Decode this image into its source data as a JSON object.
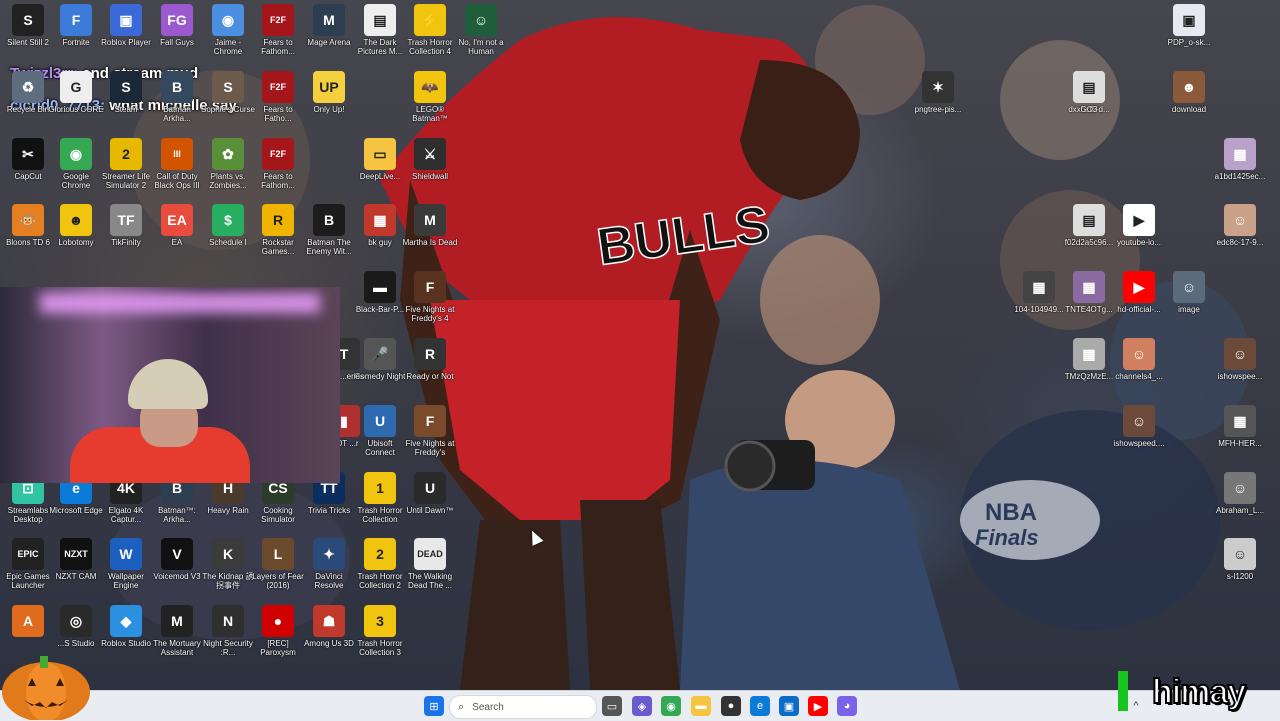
{
  "overlay_chat": [
    {
      "user": "Twizzl3rr:",
      "message": "end stream mud"
    },
    {
      "user": "cicrld0_7713:",
      "message": "what michelle say"
    }
  ],
  "desktop_icons": [
    {
      "label": "Silent Still 2",
      "glyph": "S",
      "color": "#222222"
    },
    {
      "label": "Fortnite",
      "glyph": "F",
      "color": "#3d7bd9"
    },
    {
      "label": "Roblox Player",
      "glyph": "▣",
      "color": "#3b6ad8"
    },
    {
      "label": "Fall Guys",
      "glyph": "FG",
      "color": "#9b59d0"
    },
    {
      "label": "Jaime - Chrome",
      "glyph": "◉",
      "color": "#4a8fe0"
    },
    {
      "label": "Fears to Fathom...",
      "glyph": "F2F",
      "color": "#a4161a"
    },
    {
      "label": "Mage Arena",
      "glyph": "M",
      "color": "#2c3e50"
    },
    {
      "label": "The Dark Pictures M...",
      "glyph": "▤",
      "color": "#eeeeee"
    },
    {
      "label": "Trash Horror Collection 4",
      "glyph": "⚡",
      "color": "#f1c40f"
    },
    {
      "label": "No, I'm not a Human",
      "glyph": "☺",
      "color": "#1e5e3a"
    },
    {
      "label": "Recycle Bin",
      "glyph": "♻",
      "color": "#5d6d7e"
    },
    {
      "label": "Glorious CORE",
      "glyph": "G",
      "color": "#eeeeee"
    },
    {
      "label": "Steam",
      "glyph": "S",
      "color": "#1b2838"
    },
    {
      "label": "Batman Arkha...",
      "glyph": "B",
      "color": "#34495e"
    },
    {
      "label": "Sophie's Curse",
      "glyph": "S",
      "color": "#6c5b4c"
    },
    {
      "label": "Fears to Fatho...",
      "glyph": "F2F",
      "color": "#a4161a"
    },
    {
      "label": "Only Up!",
      "glyph": "UP",
      "color": "#f4d03f"
    },
    {
      "label": "LEGO® Batman™",
      "glyph": "🦇",
      "color": "#f1c40f"
    },
    {
      "label": "CapCut",
      "glyph": "✂",
      "color": "#111111"
    },
    {
      "label": "Google Chrome",
      "glyph": "◉",
      "color": "#34a853"
    },
    {
      "label": "Streamer Life Simulator 2",
      "glyph": "2",
      "color": "#e6b800"
    },
    {
      "label": "Call of Duty Black Ops III",
      "glyph": "III",
      "color": "#d35400"
    },
    {
      "label": "Plants vs. Zombies...",
      "glyph": "✿",
      "color": "#5a8f3a"
    },
    {
      "label": "Fears to Fathom...",
      "glyph": "F2F",
      "color": "#a4161a"
    },
    {
      "label": "DeepLive...",
      "glyph": "▭",
      "color": "#f5c542"
    },
    {
      "label": "Shieldwall",
      "glyph": "⚔",
      "color": "#2e2e2e"
    },
    {
      "label": "Bloons TD 6",
      "glyph": "🐵",
      "color": "#e67e22"
    },
    {
      "label": "Lobotomy",
      "glyph": "☻",
      "color": "#f1c40f"
    },
    {
      "label": "TikFinity",
      "glyph": "TF",
      "color": "#888888"
    },
    {
      "label": "EA",
      "glyph": "EA",
      "color": "#e74c3c"
    },
    {
      "label": "Schedule I",
      "glyph": "$",
      "color": "#27ae60"
    },
    {
      "label": "Rockstar Games...",
      "glyph": "R",
      "color": "#f0b400"
    },
    {
      "label": "Batman The Enemy Wit...",
      "glyph": "B",
      "color": "#1c1c1c"
    },
    {
      "label": "bk guy",
      "glyph": "▦",
      "color": "#c0392b"
    },
    {
      "label": "Martha Is Dead",
      "glyph": "M",
      "color": "#3a3a3a"
    },
    {
      "label": "Black-Bar-P...",
      "glyph": "▬",
      "color": "#1a1a1a"
    },
    {
      "label": "Five Nights at Freddy's 4",
      "glyph": "F",
      "color": "#5a3320"
    },
    {
      "label": "Comedy Night",
      "glyph": "🎤",
      "color": "#555555"
    },
    {
      "label": "Ready or Not",
      "glyph": "R",
      "color": "#333333"
    },
    {
      "label": "The ...eries",
      "glyph": "T",
      "color": "#333333"
    },
    {
      "label": "Ubisoft Connect",
      "glyph": "U",
      "color": "#2d6ab0"
    },
    {
      "label": "Five Nights at Freddy's",
      "glyph": "F",
      "color": "#7a4a2a"
    },
    {
      "label": "...OT ...r",
      "glyph": "▮",
      "color": "#b03030"
    },
    {
      "label": "Streamlabs Desktop",
      "glyph": "⊡",
      "color": "#31c3a2"
    },
    {
      "label": "Microsoft Edge",
      "glyph": "e",
      "color": "#0c7bd8"
    },
    {
      "label": "Elgato 4K Captur...",
      "glyph": "4K",
      "color": "#222222"
    },
    {
      "label": "Batman™: Arkha...",
      "glyph": "B",
      "color": "#2c3e50"
    },
    {
      "label": "Heavy Rain",
      "glyph": "H",
      "color": "#4b3b2c"
    },
    {
      "label": "Cooking Simulator",
      "glyph": "CS",
      "color": "#2d3b2a"
    },
    {
      "label": "Trivia Tricks",
      "glyph": "TT",
      "color": "#0b2e5e"
    },
    {
      "label": "Trash Horror Collection",
      "glyph": "1",
      "color": "#f1c40f"
    },
    {
      "label": "Until Dawn™",
      "glyph": "U",
      "color": "#2a2a2a"
    },
    {
      "label": "Epic Games Launcher",
      "glyph": "EPIC",
      "color": "#222222"
    },
    {
      "label": "NZXT CAM",
      "glyph": "NZXT",
      "color": "#111111"
    },
    {
      "label": "Wallpaper Engine",
      "glyph": "W",
      "color": "#1d5fbf"
    },
    {
      "label": "Voicemod V3",
      "glyph": "V",
      "color": "#111111"
    },
    {
      "label": "The Kidnap 誘拐事件",
      "glyph": "K",
      "color": "#3b3b3b"
    },
    {
      "label": "Layers of Fear (2016)",
      "glyph": "L",
      "color": "#6b4a2e"
    },
    {
      "label": "DaVinci Resolve",
      "glyph": "✦",
      "color": "#2a4a7a"
    },
    {
      "label": "Trash Horror Collection 2",
      "glyph": "2",
      "color": "#f1c40f"
    },
    {
      "label": "The Walking Dead The ...",
      "glyph": "DEAD",
      "color": "#e8e8e8"
    },
    {
      "label": "",
      "glyph": "A",
      "color": "#e06a1e"
    },
    {
      "label": "...S Studio",
      "glyph": "◎",
      "color": "#2a2a2a"
    },
    {
      "label": "Roblox Studio",
      "glyph": "◆",
      "color": "#2d8fe0"
    },
    {
      "label": "The Mortuary Assistant",
      "glyph": "M",
      "color": "#222222"
    },
    {
      "label": "Night Security :R...",
      "glyph": "N",
      "color": "#2f2f2f"
    },
    {
      "label": "[REC] Paroxysm",
      "glyph": "●",
      "color": "#d10000"
    },
    {
      "label": "Among Us 3D",
      "glyph": "☗",
      "color": "#c0392b"
    },
    {
      "label": "Trash Horror Collection 3",
      "glyph": "3",
      "color": "#f1c40f"
    },
    {
      "label": "PDP_o-sk...",
      "glyph": "▣",
      "color": "#e8e8f2"
    },
    {
      "label": "pngtree-pis...",
      "glyph": "✶",
      "color": "#333333"
    },
    {
      "label": "dxxhcf5-d...",
      "glyph": "▦",
      "color": "#cccccc"
    },
    {
      "label": "GO3",
      "glyph": "▤",
      "color": "#dddddd"
    },
    {
      "label": "download",
      "glyph": "☻",
      "color": "#8a5a3a"
    },
    {
      "label": "a1bd1425ec...",
      "glyph": "▦",
      "color": "#b9a1c9"
    },
    {
      "label": "f02d2a5c96...",
      "glyph": "▤",
      "color": "#dddddd"
    },
    {
      "label": "youtube-lo...",
      "glyph": "▶",
      "color": "#ffffff"
    },
    {
      "label": "edc8c-17-9...",
      "glyph": "☺",
      "color": "#caa28a"
    },
    {
      "label": "104-104949...",
      "glyph": "▦",
      "color": "#444444"
    },
    {
      "label": "TNTE4OTg...",
      "glyph": "▦",
      "color": "#8a6aa0"
    },
    {
      "label": "hd-official-...",
      "glyph": "▶",
      "color": "#ff0000"
    },
    {
      "label": "image",
      "glyph": "☺",
      "color": "#5b6b7b"
    },
    {
      "label": "TMzQzMzE...",
      "glyph": "▦",
      "color": "#aaaaaa"
    },
    {
      "label": "channels4_...",
      "glyph": "☺",
      "color": "#d08060"
    },
    {
      "label": "ishowspee...",
      "glyph": "☺",
      "color": "#6b4a3a"
    },
    {
      "label": "ishowspeed....",
      "glyph": "☺",
      "color": "#6b4a3a"
    },
    {
      "label": "MFH-HER...",
      "glyph": "▦",
      "color": "#555555"
    },
    {
      "label": "Abraham_L...",
      "glyph": "☺",
      "color": "#777777"
    },
    {
      "label": "s-l1200",
      "glyph": "☺",
      "color": "#cccccc"
    }
  ],
  "taskbar": {
    "search_label": "Search",
    "apps": [
      {
        "name": "windows-start",
        "glyph": "⊞",
        "color": "#1a73e8"
      },
      {
        "name": "search-widget",
        "glyph": "✿",
        "color": "#ff8c00"
      },
      {
        "name": "task-view",
        "glyph": "▭",
        "color": "#555555"
      },
      {
        "name": "copilot",
        "glyph": "◈",
        "color": "#6a5acd"
      },
      {
        "name": "chrome",
        "glyph": "◉",
        "color": "#34a853"
      },
      {
        "name": "file-explorer",
        "glyph": "▬",
        "color": "#f5c542"
      },
      {
        "name": "obs",
        "glyph": "●",
        "color": "#333333"
      },
      {
        "name": "edge",
        "glyph": "e",
        "color": "#0c7bd8"
      },
      {
        "name": "store",
        "glyph": "▣",
        "color": "#0b6bcb"
      },
      {
        "name": "youtube",
        "glyph": "▶",
        "color": "#ff0000"
      },
      {
        "name": "discord",
        "glyph": "◕",
        "color": "#7a63e8"
      }
    ],
    "tray_caret": "^"
  },
  "watermark_text": "himay"
}
